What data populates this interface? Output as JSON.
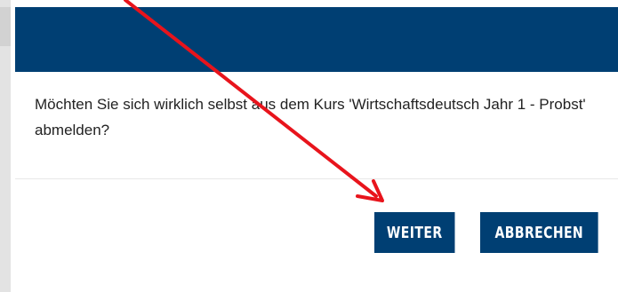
{
  "dialog": {
    "message": "Möchten Sie sich wirklich selbst aus dem Kurs 'Wirtschaftsdeutsch Jahr 1 - Probst' abmelden?",
    "confirm_label": "WEITER",
    "cancel_label": "ABBRECHEN"
  },
  "colors": {
    "header": "#003f73",
    "button": "#003f73",
    "annotation_arrow": "#e8141c"
  },
  "icons": {
    "annotation": "red-arrow-icon"
  }
}
